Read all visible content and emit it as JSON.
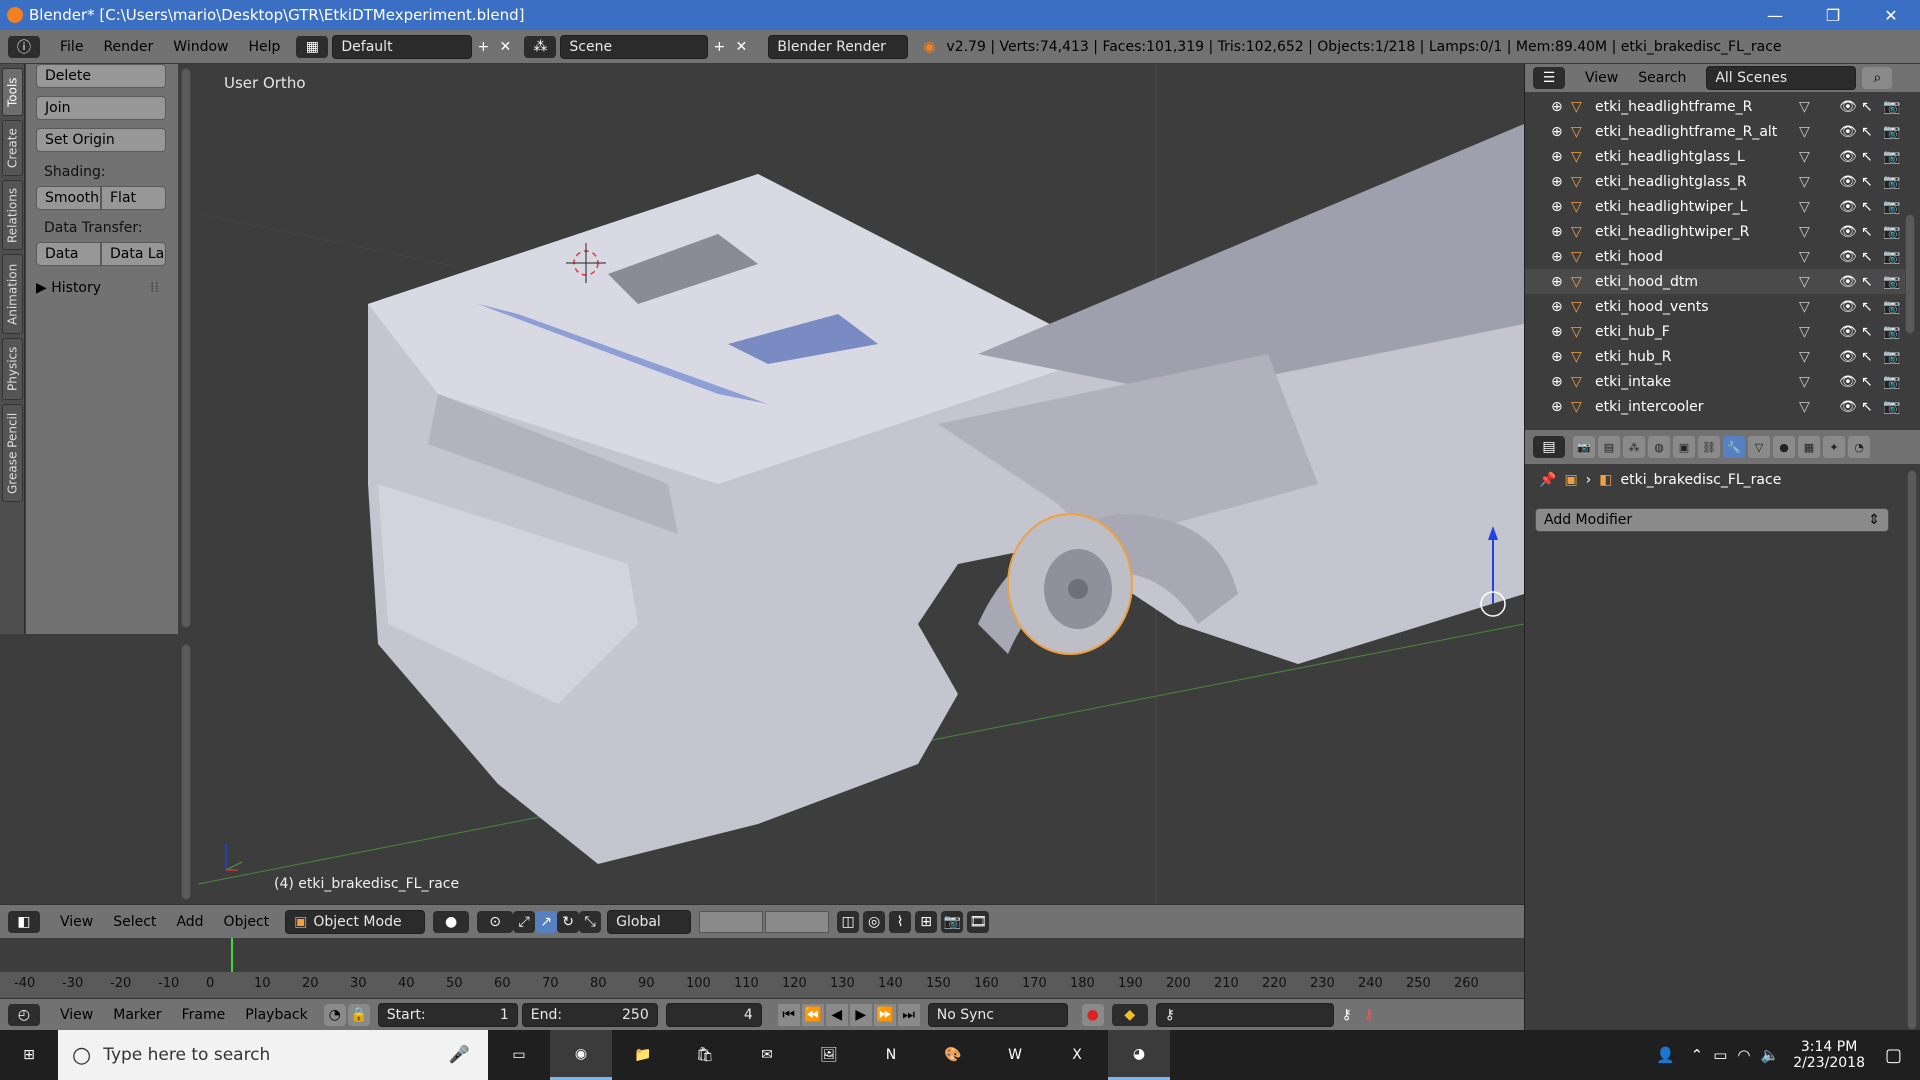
{
  "window": {
    "title": "Blender* [C:\\Users\\mario\\Desktop\\GTR\\EtkiDTMexperiment.blend]",
    "minimize": "—",
    "restore": "❐",
    "close": "✕"
  },
  "infobar": {
    "menus": [
      "File",
      "Render",
      "Window",
      "Help"
    ],
    "layout": "Default",
    "scene": "Scene",
    "engine": "Blender Render",
    "stats": "v2.79 | Verts:74,413 | Faces:101,319 | Tris:102,652 | Objects:1/218 | Lamps:0/1 | Mem:89.40M | etki_brakedisc_FL_race"
  },
  "toolshelf": {
    "tabs": [
      "Tools",
      "Create",
      "Relations",
      "Animation",
      "Physics",
      "Grease Pencil"
    ],
    "delete": "Delete",
    "join": "Join",
    "set_origin": "Set Origin",
    "shading_label": "Shading:",
    "smooth": "Smooth",
    "flat": "Flat",
    "data_transfer_label": "Data Transfer:",
    "data": "Data",
    "data_la": "Data La",
    "history": "History"
  },
  "viewport": {
    "view_name": "User Ortho",
    "object_label": "(4) etki_brakedisc_FL_race"
  },
  "view_header": {
    "menus": [
      "View",
      "Select",
      "Add",
      "Object"
    ],
    "mode": "Object Mode",
    "orientation": "Global"
  },
  "timeline": {
    "ticks": [
      "-40",
      "-30",
      "-20",
      "-10",
      "0",
      "10",
      "20",
      "30",
      "40",
      "50",
      "60",
      "70",
      "80",
      "90",
      "100",
      "110",
      "120",
      "130",
      "140",
      "150",
      "160",
      "170",
      "180",
      "190",
      "200",
      "210",
      "220",
      "230",
      "240",
      "250",
      "260"
    ],
    "current_frame": 4
  },
  "timeline_header": {
    "menus": [
      "View",
      "Marker",
      "Frame",
      "Playback"
    ],
    "start_label": "Start:",
    "start": "1",
    "end_label": "End:",
    "end": "250",
    "frame": "4",
    "sync": "No Sync"
  },
  "outliner": {
    "menus": [
      "View",
      "Search"
    ],
    "filter": "All Scenes",
    "items": [
      "etki_headlightframe_R",
      "etki_headlightframe_R_alt",
      "etki_headlightglass_L",
      "etki_headlightglass_R",
      "etki_headlightwiper_L",
      "etki_headlightwiper_R",
      "etki_hood",
      "etki_hood_dtm",
      "etki_hood_vents",
      "etki_hub_F",
      "etki_hub_R",
      "etki_intake",
      "etki_intercooler"
    ],
    "selected_index": 7
  },
  "properties": {
    "object": "etki_brakedisc_FL_race",
    "add_modifier": "Add Modifier"
  },
  "taskbar": {
    "search_placeholder": "Type here to search",
    "time": "3:14 PM",
    "date": "2/23/2018"
  },
  "colors": {
    "title_bar": "#3b6fc4",
    "panel": "#727272",
    "viewport": "#3d3d3d",
    "selected_object": "#f0a040",
    "active_tab": "#5680c2"
  }
}
